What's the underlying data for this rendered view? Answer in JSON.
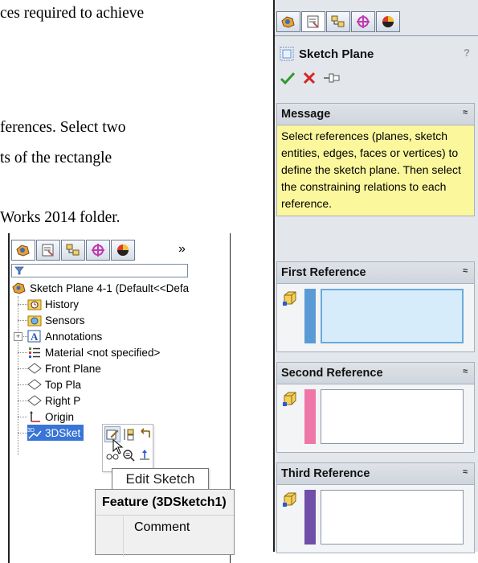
{
  "doc": {
    "lines": [
      "ces required to achieve",
      "ferences. Select two",
      "ts of the rectangle",
      "Works 2014 folder."
    ]
  },
  "feature_manager": {
    "tabs": [
      "feature-manager-icon",
      "property-manager-icon",
      "configuration-manager-icon",
      "dimxpert-manager-icon",
      "display-manager-icon"
    ],
    "more": "»",
    "root": "Sketch Plane 4-1  (Default<<Defa",
    "items": [
      {
        "label": "History",
        "icon": "history-icon"
      },
      {
        "label": "Sensors",
        "icon": "sensors-icon"
      },
      {
        "label": "Annotations",
        "icon": "annotations-icon"
      },
      {
        "label": "Material <not specified>",
        "icon": "material-icon"
      },
      {
        "label": "Front Plane",
        "icon": "plane-icon"
      },
      {
        "label": "Top Pla",
        "icon": "plane-icon"
      },
      {
        "label": "Right P",
        "icon": "plane-icon"
      },
      {
        "label": "Origin",
        "icon": "origin-icon"
      },
      {
        "label": "3DSket",
        "icon": "3d-sketch-icon"
      }
    ],
    "tooltip": "Edit Sketch",
    "context_menu": {
      "header": "Feature (3DSketch1)",
      "items": [
        "Comment"
      ]
    }
  },
  "property_manager": {
    "title": "Sketch Plane",
    "help": "?",
    "message": {
      "header": "Message",
      "text": "Select references (planes, sketch entities, edges, faces or vertices) to define the sketch plane. Then select the constraining relations to each reference."
    },
    "references": [
      {
        "header": "First Reference",
        "color": "#5b9bd5",
        "active": true
      },
      {
        "header": "Second Reference",
        "color": "#ef77a7",
        "active": false
      },
      {
        "header": "Third Reference",
        "color": "#6f4fa7",
        "active": false
      }
    ],
    "collapse_glyph": "≈"
  },
  "colors": {
    "message_bg": "#fbf79c",
    "selection": "#3875d7",
    "panel_bg": "#e3e6ea"
  }
}
